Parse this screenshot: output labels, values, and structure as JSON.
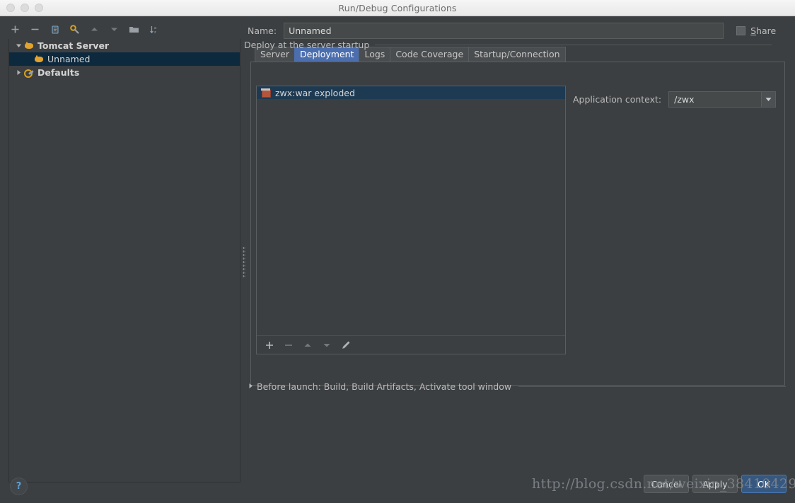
{
  "window": {
    "title": "Run/Debug Configurations",
    "traffic_lights": [
      "close",
      "minimize",
      "zoom"
    ]
  },
  "sidebar": {
    "toolbar": [
      {
        "name": "add-icon",
        "glyph": "+"
      },
      {
        "name": "remove-icon",
        "glyph": "−"
      },
      {
        "name": "copy-icon",
        "glyph": "❐"
      },
      {
        "name": "edit-defaults-icon",
        "glyph": "⚙"
      },
      {
        "name": "move-up-icon",
        "glyph": "▲"
      },
      {
        "name": "move-down-icon",
        "glyph": "▼"
      },
      {
        "name": "new-folder-icon",
        "glyph": "▬"
      },
      {
        "name": "sort-alphabetically-icon",
        "glyph": "↓"
      }
    ],
    "tree": [
      {
        "label": "Tomcat Server",
        "icon": "tomcat-icon",
        "expanded": true,
        "indent": 0,
        "selected": false,
        "bold": true
      },
      {
        "label": "Unnamed",
        "icon": "tomcat-icon",
        "expanded": null,
        "indent": 1,
        "selected": true,
        "bold": false
      },
      {
        "label": "Defaults",
        "icon": "wrench-icon",
        "expanded": false,
        "indent": 0,
        "selected": false,
        "bold": true
      }
    ]
  },
  "form": {
    "name_label": "Name:",
    "name_value": "Unnamed",
    "name_placeholder": "Unnamed",
    "share_label": "Share",
    "share_mnemonic": "S",
    "share_checked": false
  },
  "tabs": [
    {
      "label": "Server",
      "active": false
    },
    {
      "label": "Deployment",
      "active": true
    },
    {
      "label": "Logs",
      "active": false
    },
    {
      "label": "Code Coverage",
      "active": false
    },
    {
      "label": "Startup/Connection",
      "active": false
    }
  ],
  "deployment": {
    "group_title": "Deploy at the server startup",
    "artifacts": [
      {
        "label": "zwx:war exploded",
        "icon": "artifact-icon",
        "selected": true
      }
    ],
    "list_toolbar": [
      {
        "name": "add-artifact-icon",
        "glyph": "+"
      },
      {
        "name": "remove-artifact-icon",
        "glyph": "−"
      },
      {
        "name": "move-up-icon",
        "glyph": "▲"
      },
      {
        "name": "move-down-icon",
        "glyph": "▼"
      },
      {
        "name": "edit-icon",
        "glyph": "✎"
      }
    ],
    "context_label": "Application context:",
    "context_value": "/zwx",
    "context_options": [
      "/zwx"
    ]
  },
  "before_launch": {
    "text": "Before launch: Build, Build Artifacts, Activate tool window",
    "expanded": false
  },
  "footer": {
    "help_glyph": "?",
    "buttons": [
      {
        "label": "Cancel",
        "default": false
      },
      {
        "label": "Apply",
        "default": false
      },
      {
        "label": "OK",
        "default": true
      }
    ]
  },
  "watermark": {
    "text": "http://blog.csdn.net/weixin_38410429"
  },
  "colors": {
    "panel_bg": "#3c3f41",
    "titlebar_bg": "#f0f0f0",
    "accent_tab": "#4b6eaf",
    "selection_tree": "#0d293e",
    "selection_list": "#1d3a52",
    "default_button": "#365880",
    "text": "#bbbbbb",
    "border": "#5b5e60"
  }
}
